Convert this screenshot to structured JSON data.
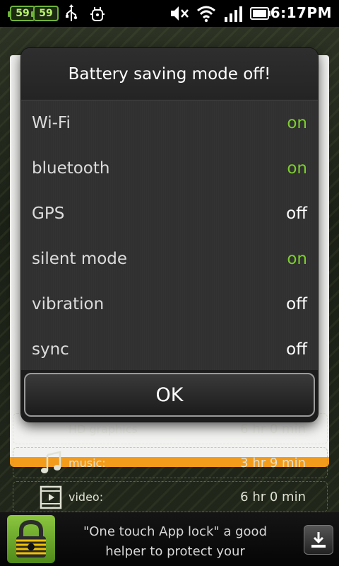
{
  "status_bar": {
    "badge_left": "59",
    "badge_right": "59",
    "time": "6:17PM",
    "icons": [
      "battery-badge-icon",
      "battery-badge-icon",
      "usb-icon",
      "debug-icon",
      "mute-icon",
      "wifi-icon",
      "signal-icon",
      "battery-icon"
    ]
  },
  "background_app": {
    "rows": [
      {
        "label": "HD graphics",
        "value": "6 hr 0 min",
        "icon": "graphics-icon"
      },
      {
        "label": "music:",
        "value": "3 hr  9 min",
        "icon": "music-icon"
      },
      {
        "label": "video:",
        "value": "6 hr  0 min",
        "icon": "video-icon"
      }
    ],
    "accent_color": "#f39b1b"
  },
  "dialog": {
    "title": "Battery saving mode off!",
    "settings": [
      {
        "name": "Wi-Fi",
        "state": "on"
      },
      {
        "name": "bluetooth",
        "state": "on"
      },
      {
        "name": "GPS",
        "state": "off"
      },
      {
        "name": "silent mode",
        "state": "on"
      },
      {
        "name": "vibration",
        "state": "off"
      },
      {
        "name": "sync",
        "state": "off"
      }
    ],
    "ok_label": "OK",
    "on_color": "#7ccd2e",
    "off_color": "#ffffff"
  },
  "ad": {
    "line1": "\"One touch App lock\" a good",
    "line2": "helper to protect your",
    "icons": [
      "lock-icon",
      "download-icon"
    ]
  }
}
